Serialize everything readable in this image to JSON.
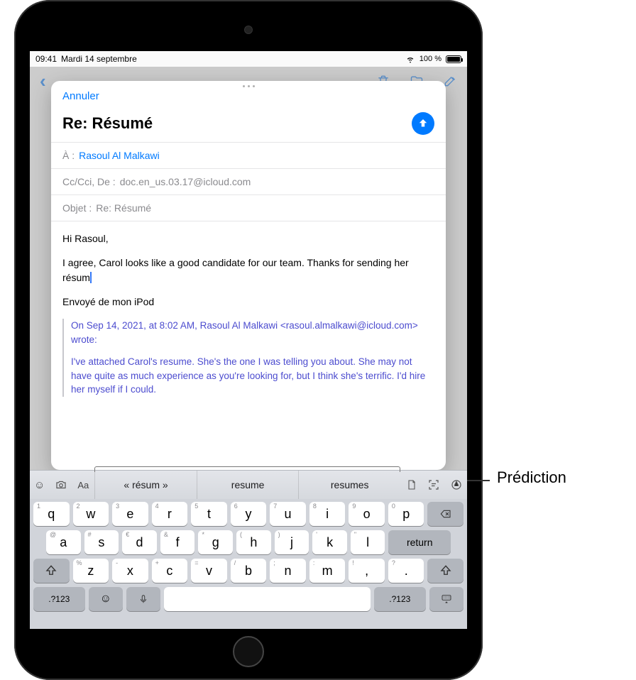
{
  "status": {
    "time": "09:41",
    "date": "Mardi 14 septembre",
    "battery_text": "100 %"
  },
  "bgNav": {
    "back_chevron": "‹"
  },
  "sheet": {
    "cancel": "Annuler",
    "title": "Re: Résumé",
    "to_label": "À :",
    "to_recipient": "Rasoul Al Malkawi",
    "cc_label": "Cc/Cci, De :",
    "cc_value": "doc.en_us.03.17@icloud.com",
    "subject_label": "Objet :",
    "subject_value": "Re: Résumé",
    "body_greeting": "Hi Rasoul,",
    "body_line": "I agree, Carol looks like a good candidate for our team. Thanks for sending her résum",
    "signature": "Envoyé de mon iPod",
    "quote_header": "On Sep 14, 2021, at 8:02 AM, Rasoul Al Malkawi <rasoul.almalkawi@icloud.com> wrote:",
    "quote_body": "I've attached Carol's resume. She's the one I was telling you about. She may not have quite as much experience as you're looking for, but I think she's terrific. I'd hire her myself if I could."
  },
  "predictions": [
    "« résum »",
    "resume",
    "resumes"
  ],
  "keyboard": {
    "row1": [
      {
        "k": "q",
        "s": "1"
      },
      {
        "k": "w",
        "s": "2"
      },
      {
        "k": "e",
        "s": "3"
      },
      {
        "k": "r",
        "s": "4"
      },
      {
        "k": "t",
        "s": "5"
      },
      {
        "k": "y",
        "s": "6"
      },
      {
        "k": "u",
        "s": "7"
      },
      {
        "k": "i",
        "s": "8"
      },
      {
        "k": "o",
        "s": "9"
      },
      {
        "k": "p",
        "s": "0"
      }
    ],
    "row2": [
      {
        "k": "a",
        "s": "@"
      },
      {
        "k": "s",
        "s": "#"
      },
      {
        "k": "d",
        "s": "€"
      },
      {
        "k": "f",
        "s": "&"
      },
      {
        "k": "g",
        "s": "*"
      },
      {
        "k": "h",
        "s": "("
      },
      {
        "k": "j",
        "s": ")"
      },
      {
        "k": "k",
        "s": "'"
      },
      {
        "k": "l",
        "s": "\""
      }
    ],
    "row3": [
      {
        "k": "z",
        "s": "%"
      },
      {
        "k": "x",
        "s": "-"
      },
      {
        "k": "c",
        "s": "+"
      },
      {
        "k": "v",
        "s": "="
      },
      {
        "k": "b",
        "s": "/"
      },
      {
        "k": "n",
        "s": ";"
      },
      {
        "k": "m",
        "s": ":"
      }
    ],
    "return": "return",
    "numkey": ".?123",
    "commaKey": {
      "k": ",",
      "s": "!"
    },
    "periodKey": {
      "k": ".",
      "s": "?"
    }
  },
  "annotation": "Prédiction"
}
